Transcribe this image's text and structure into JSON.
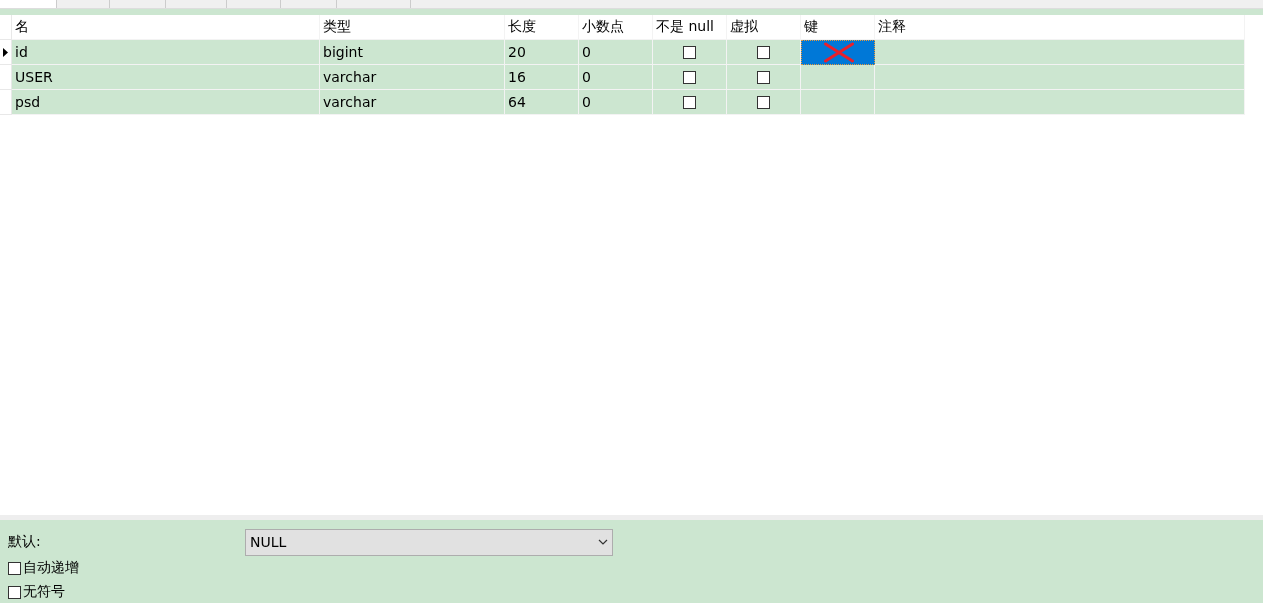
{
  "tabs": [
    {
      "selected": true
    },
    {
      "selected": false
    },
    {
      "selected": false
    },
    {
      "selected": false
    },
    {
      "selected": false
    },
    {
      "selected": false
    },
    {
      "selected": false
    }
  ],
  "table": {
    "columns": [
      "名",
      "类型",
      "长度",
      "小数点",
      "不是 null",
      "虚拟",
      "键",
      "注释"
    ],
    "rows": [
      {
        "current": true,
        "name": "id",
        "type": "bigint",
        "length": "20",
        "decimals": "0",
        "not_null": false,
        "virtual": false,
        "key_selected": true
      },
      {
        "current": false,
        "name": "USER",
        "type": "varchar",
        "length": "16",
        "decimals": "0",
        "not_null": false,
        "virtual": false,
        "key_selected": false
      },
      {
        "current": false,
        "name": "psd",
        "type": "varchar",
        "length": "64",
        "decimals": "0",
        "not_null": false,
        "virtual": false,
        "key_selected": false
      }
    ]
  },
  "properties": {
    "default_label": "默认:",
    "default_value": "NULL",
    "options": [
      {
        "label": "自动递增",
        "checked": false
      },
      {
        "label": "无符号",
        "checked": false
      }
    ]
  }
}
